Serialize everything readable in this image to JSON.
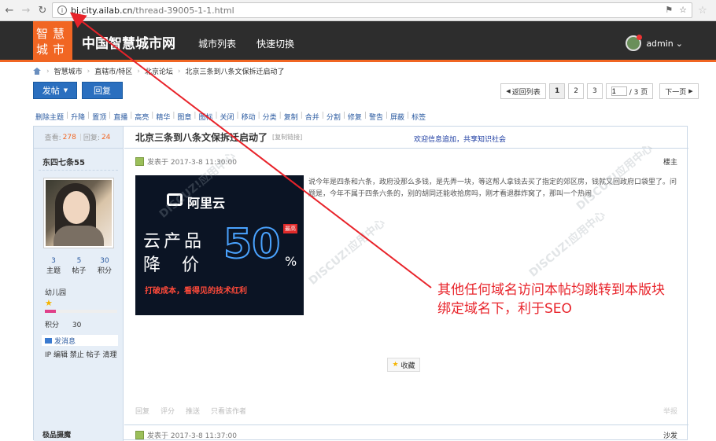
{
  "browser": {
    "host": "bj.city.ailab.cn",
    "path": "/thread-39005-1-1.html"
  },
  "header": {
    "logo": "智慧城市",
    "site_name": "中国智慧城市网",
    "nav": [
      "城市列表",
      "快速切换"
    ],
    "user": "admin"
  },
  "breadcrumb": [
    "智慧城市",
    "直辖市/特区",
    "北京论坛",
    "北京三条到八条文保拆迁启动了"
  ],
  "toolbar": {
    "post_label": "发帖",
    "reply_label": "回复"
  },
  "pager": {
    "back_label": "返回列表",
    "pages": [
      "1",
      "2",
      "3"
    ],
    "current_input": "1",
    "total": "/ 3 页",
    "next_label": "下一页"
  },
  "mod_actions": [
    "删除主题",
    "升降",
    "置顶",
    "直播",
    "高亮",
    "精华",
    "图章",
    "图标",
    "关闭",
    "移动",
    "分类",
    "复制",
    "合并",
    "分割",
    "修复",
    "警告",
    "屏蔽",
    "标签"
  ],
  "stats": {
    "views_label": "查看:",
    "views": "278",
    "replies_label": "回复:",
    "replies": "24"
  },
  "author": {
    "name": "东四七条55",
    "topics": "3",
    "posts": "5",
    "credits": "30",
    "topics_label": "主题",
    "posts_label": "帖子",
    "credits_label": "积分",
    "group": "幼儿园",
    "points_label": "积分",
    "points": "30",
    "level_fraction": 0.15,
    "send_msg": "发消息",
    "admin_links": "IP 编辑 禁止 帖子 清理"
  },
  "thread": {
    "title": "北京三条到八条文保拆迁启动了",
    "copy_link": "[复制链接]",
    "marquee": "欢迎信息追加，共享知识社会",
    "posted": "发表于 2017-3-8 11:30:00",
    "floor": "楼主",
    "body": "说今年是四条和六条，政府没那么多钱，是先弄一块，等这帮人拿钱去买了指定的郊区房，钱就又回政府口袋里了。问题是，今年不属于四条六条的，别的胡同还能收拾房吗，刚才看退群炸窝了，那叫一个热闹",
    "favorite": "收藏",
    "actions": [
      "回复",
      "评分",
      "推送",
      "只看该作者"
    ],
    "report": "举报"
  },
  "ad": {
    "brand": "阿里云",
    "line1": "云产品",
    "line2": "降 价",
    "big": "50",
    "pct": "%",
    "badge": "最高",
    "footer": "打破成本，看得见的技术红利"
  },
  "post2": {
    "author": "极品摄魔",
    "posted": "发表于 2017-3-8 11:37:00",
    "floor": "沙发"
  },
  "annotation": {
    "line1": "其他任何域名访问本帖均跳转到本版块",
    "line2": "绑定域名下，利于SEO"
  },
  "watermark": "DISCUZ!应用中心",
  "colors": {
    "accent": "#f16623",
    "header_bg": "#2d2d2d",
    "link": "#2a5aa0",
    "annotation": "#e8232a"
  }
}
